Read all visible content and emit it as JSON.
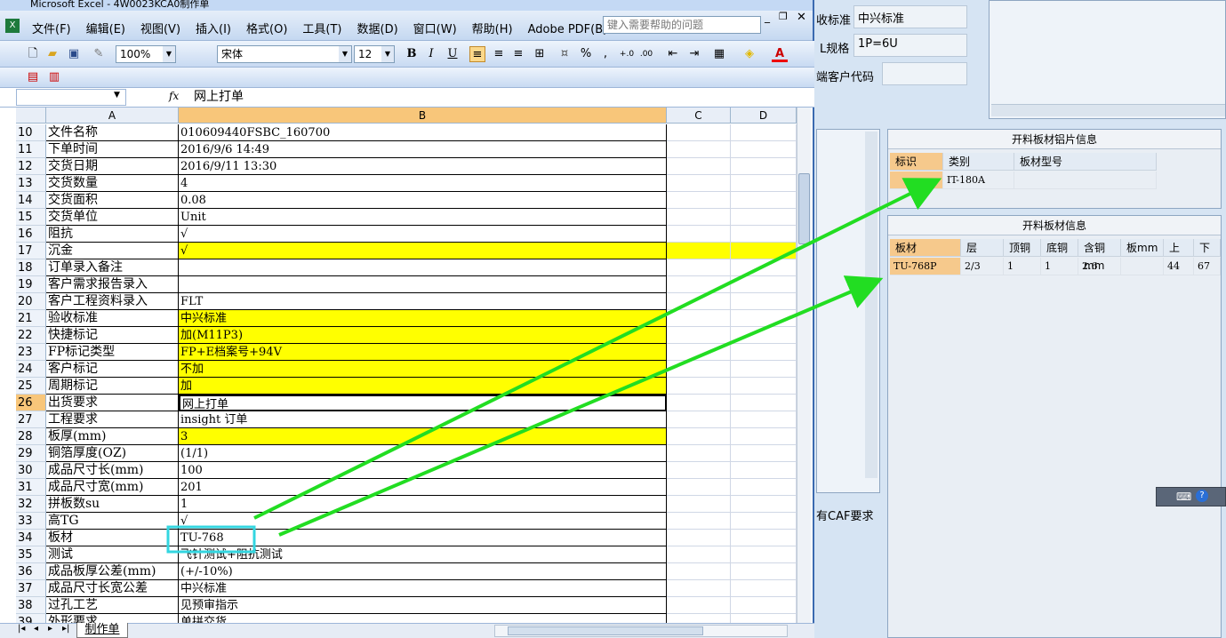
{
  "window_title": "Microsoft Excel - 4W0023KCA0制作单",
  "menu": [
    "文件(F)",
    "编辑(E)",
    "视图(V)",
    "插入(I)",
    "格式(O)",
    "工具(T)",
    "数据(D)",
    "窗口(W)",
    "帮助(H)",
    "Adobe PDF(B)"
  ],
  "help_placeholder": "键入需要帮助的问题",
  "toolbar": {
    "zoom": "100%",
    "font": "宋体",
    "size": "12",
    "bold": "B",
    "italic": "I",
    "underline": "U",
    "percent": "%",
    "comma": ","
  },
  "formula_bar": {
    "name_box": "",
    "fx": "fx",
    "content": "网上打单"
  },
  "columns": [
    "A",
    "B",
    "C",
    "D"
  ],
  "rows": [
    {
      "n": "10",
      "a": "文件名称",
      "b": "010609440FSBC_160700",
      "y": false
    },
    {
      "n": "11",
      "a": "下单时间",
      "b": "2016/9/6 14:49",
      "y": false
    },
    {
      "n": "12",
      "a": "交货日期",
      "b": "2016/9/11 13:30",
      "y": false
    },
    {
      "n": "13",
      "a": "交货数量",
      "b": "4",
      "y": false
    },
    {
      "n": "14",
      "a": "交货面积",
      "b": "0.08",
      "y": false
    },
    {
      "n": "15",
      "a": "交货单位",
      "b": "Unit",
      "y": false
    },
    {
      "n": "16",
      "a": "阻抗",
      "b": "√",
      "y": false
    },
    {
      "n": "17",
      "a": "沉金",
      "b": "√",
      "y": true,
      "full": true
    },
    {
      "n": "18",
      "a": "订单录入备注",
      "b": "",
      "y": false
    },
    {
      "n": "19",
      "a": "客户需求报告录入",
      "b": "",
      "y": false
    },
    {
      "n": "20",
      "a": "客户工程资料录入",
      "b": "FLT",
      "y": false
    },
    {
      "n": "21",
      "a": "验收标准",
      "b": "中兴标准",
      "y": true
    },
    {
      "n": "22",
      "a": "快捷标记",
      "b": "加(M11P3)",
      "y": true
    },
    {
      "n": "23",
      "a": "FP标记类型",
      "b": "FP+E档案号+94V",
      "y": true
    },
    {
      "n": "24",
      "a": "客户标记",
      "b": "不加",
      "y": true
    },
    {
      "n": "25",
      "a": "周期标记",
      "b": "加",
      "y": true
    },
    {
      "n": "26",
      "a": "出货要求",
      "b": "网上打单",
      "y": false,
      "active": true
    },
    {
      "n": "27",
      "a": "工程要求",
      "b": "insight 订单",
      "y": false
    },
    {
      "n": "28",
      "a": "板厚(mm)",
      "b": "3",
      "y": true
    },
    {
      "n": "29",
      "a": "铜箔厚度(OZ)",
      "b": " (1/1)",
      "y": false
    },
    {
      "n": "30",
      "a": "成品尺寸长(mm)",
      "b": "100",
      "y": false
    },
    {
      "n": "31",
      "a": "成品尺寸宽(mm)",
      "b": "201",
      "y": false
    },
    {
      "n": "32",
      "a": "拼板数su",
      "b": "1",
      "y": false
    },
    {
      "n": "33",
      "a": "高TG",
      "b": "√",
      "y": false
    },
    {
      "n": "34",
      "a": "板材",
      "b": "TU-768",
      "y": false
    },
    {
      "n": "35",
      "a": "测试",
      "b": "飞针测试+阻抗测试",
      "y": false
    },
    {
      "n": "36",
      "a": "成品板厚公差(mm)",
      "b": "(+/-10%)",
      "y": false
    },
    {
      "n": "37",
      "a": "成品尺寸长宽公差",
      "b": "中兴标准",
      "y": false
    },
    {
      "n": "38",
      "a": "过孔工艺",
      "b": "见预审指示",
      "y": false
    },
    {
      "n": "39",
      "a": "外形要求",
      "b": "单拼交货",
      "y": false
    }
  ],
  "sheet_tab": "制作单",
  "right_app": {
    "field1_label": "收标准",
    "field1_value": "中兴标准",
    "field2_label": "L规格",
    "field2_value": "1P=6U",
    "field3_label": "端客户代码",
    "field3_value": "",
    "foil_panel": {
      "title": "开料板材铝片信息",
      "headers": [
        "标识",
        "类别",
        "板材型号"
      ],
      "row": [
        "",
        "IT-180A",
        ""
      ]
    },
    "board_panel": {
      "title": "开料板材信息",
      "headers": [
        "板材",
        "层",
        "顶铜",
        "底铜",
        "含铜mm",
        "板mm",
        "上",
        "下"
      ],
      "row": [
        "TU-768P",
        "2/3",
        "1",
        "1",
        "2.6",
        "",
        "44",
        "67"
      ]
    },
    "caf_text": "有CAF要求"
  },
  "colors": {
    "highlight": "#ffff00",
    "arrow": "#22dd22",
    "callout": "#33d6e0"
  }
}
